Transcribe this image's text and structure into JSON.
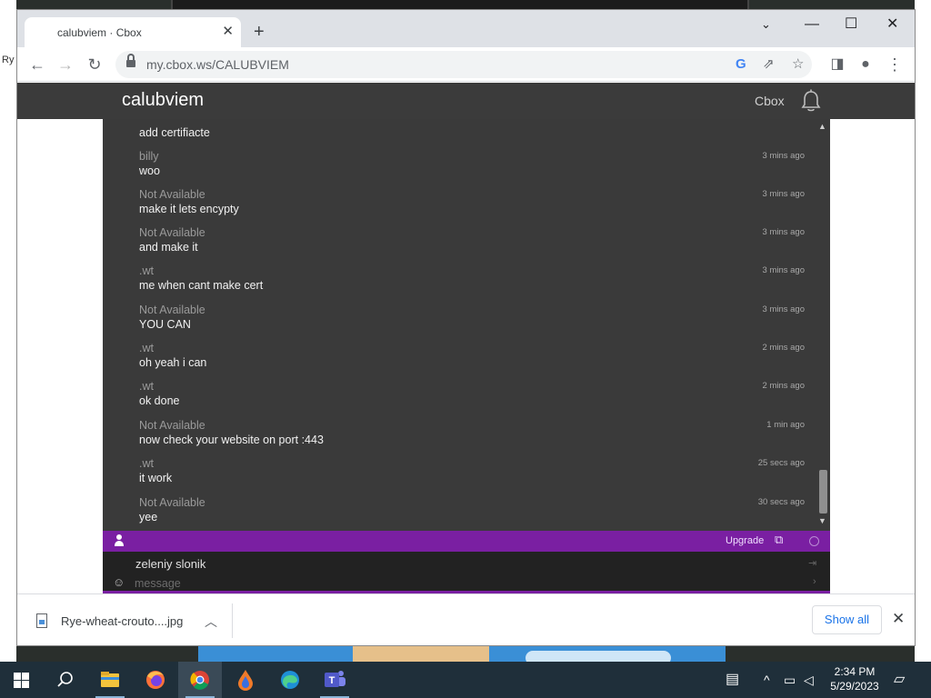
{
  "desktop": {
    "side_label": "Ry"
  },
  "browser": {
    "tab_title": "calubviem · Cbox",
    "url": "my.cbox.ws/CALUBVIEM"
  },
  "cbox": {
    "title": "calubviem",
    "header_link": "Cbox",
    "messages": [
      {
        "name": "",
        "text": "add certifiacte",
        "time": ""
      },
      {
        "name": "billy",
        "text": "woo",
        "time": "3 mins ago"
      },
      {
        "name": "Not Available",
        "text": "make it lets encypty",
        "time": "3 mins ago"
      },
      {
        "name": "Not Available",
        "text": "and make it",
        "time": "3 mins ago"
      },
      {
        "name": ".wt",
        "text": "me when cant make cert",
        "time": "3 mins ago"
      },
      {
        "name": "Not Available",
        "text": "YOU CAN",
        "time": "3 mins ago"
      },
      {
        "name": ".wt",
        "text": "oh yeah i can",
        "time": "2 mins ago"
      },
      {
        "name": ".wt",
        "text": "ok done",
        "time": "2 mins ago"
      },
      {
        "name": "Not Available",
        "text": "now check your website on port :443",
        "time": "1 min ago"
      },
      {
        "name": ".wt",
        "text": "it work",
        "time": "25 secs ago"
      },
      {
        "name": "Not Available",
        "text": "yee",
        "time": "30 secs ago"
      }
    ],
    "bar": {
      "upgrade_label": "Upgrade",
      "color": "#7a1fa2"
    },
    "input": {
      "username": "zeleniy slonik",
      "message_placeholder": "message"
    }
  },
  "download": {
    "filename": "Rye-wheat-crouto....jpg",
    "show_all_label": "Show all"
  },
  "taskbar": {
    "time": "2:34 PM",
    "date": "5/29/2023"
  }
}
